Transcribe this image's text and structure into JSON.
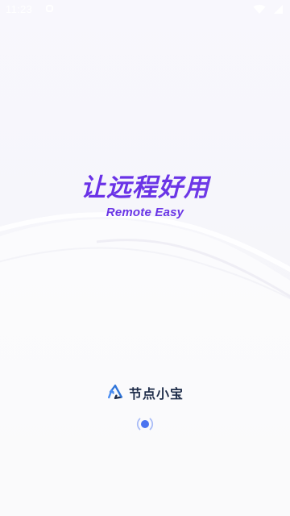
{
  "status_bar": {
    "time": "11:23"
  },
  "splash": {
    "headline": "让远程好用",
    "subline": "Remote Easy",
    "brand_name": "节点小宝"
  },
  "icons": {
    "notification": "notification-icon",
    "wifi": "wifi-icon",
    "signal": "signal-icon",
    "logo": "brand-logo-icon",
    "loading": "loading-spinner-icon"
  },
  "colors": {
    "accent": "#6a35e6",
    "brand_text": "#1f2d4a",
    "logo_blue": "#2e74d9",
    "spinner": "#4a73f0"
  }
}
